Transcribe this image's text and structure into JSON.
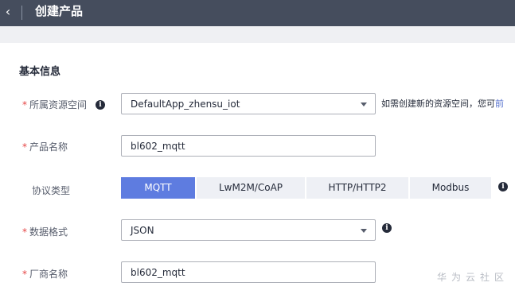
{
  "header": {
    "back_icon": "chevron-left-icon",
    "title": "创建产品"
  },
  "section": {
    "title": "基本信息"
  },
  "fields": {
    "resource_space": {
      "required_mark": "*",
      "label": "所属资源空间",
      "value": "DefaultApp_zhensu_iot",
      "hint": "如需创建新的资源空间，您可",
      "hint_link": "前"
    },
    "product_name": {
      "required_mark": "*",
      "label": "产品名称",
      "value": "bl602_mqtt"
    },
    "protocol": {
      "label": "协议类型",
      "options": [
        "MQTT",
        "LwM2M/CoAP",
        "HTTP/HTTP2",
        "Modbus"
      ],
      "selected": "MQTT"
    },
    "data_format": {
      "required_mark": "*",
      "label": "数据格式",
      "value": "JSON"
    },
    "vendor_name": {
      "required_mark": "*",
      "label": "厂商名称",
      "value": "bl602_mqtt"
    }
  },
  "info_icon_glyph": "i",
  "watermark": "华为云社区",
  "colors": {
    "header_bg": "#454d5d",
    "accent": "#5e7ce0",
    "required": "#e54545",
    "link": "#526ecc"
  }
}
